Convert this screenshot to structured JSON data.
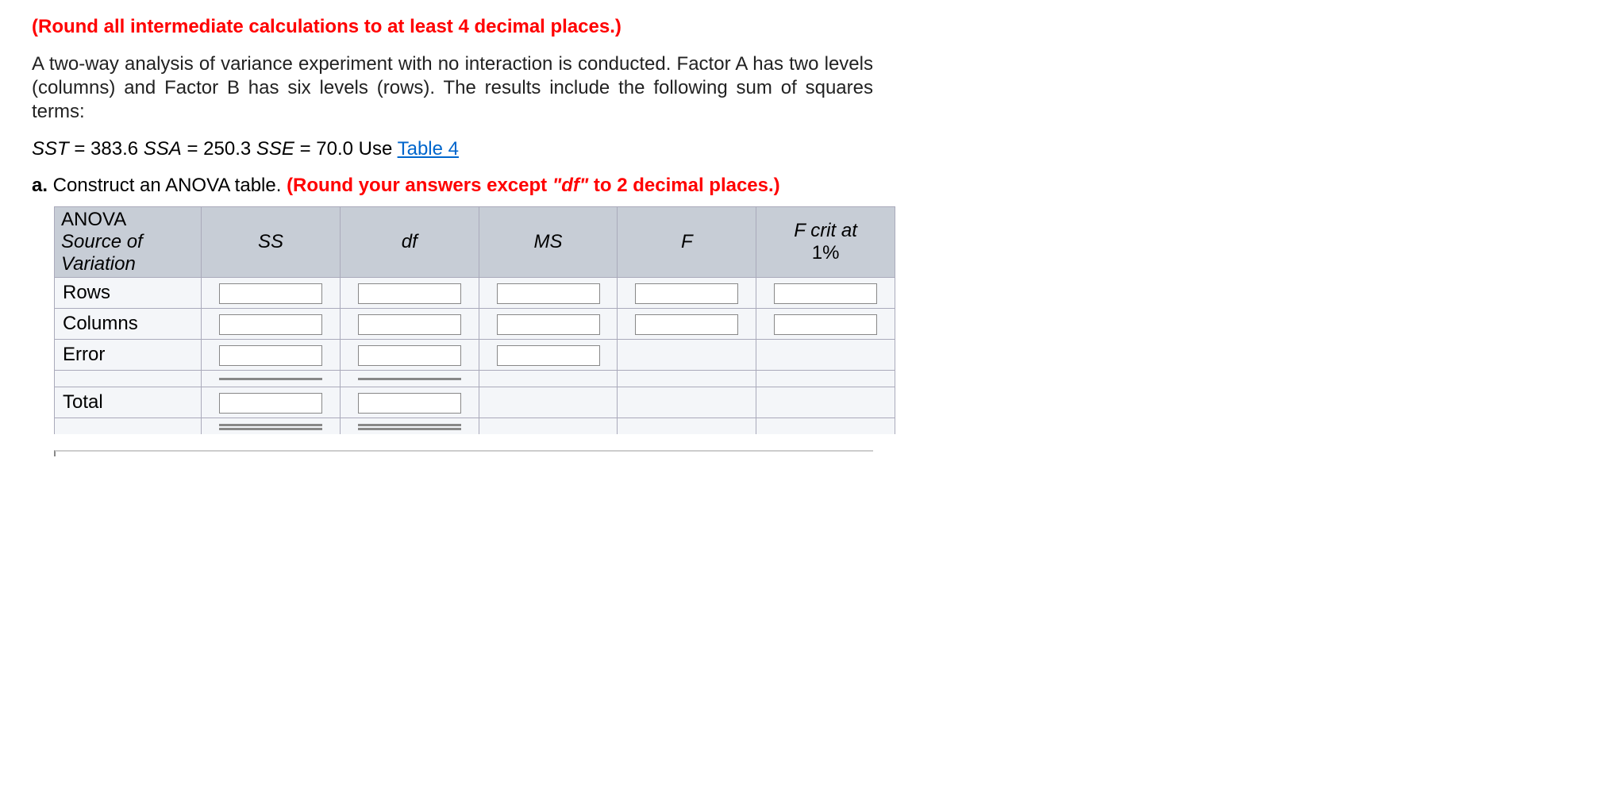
{
  "instruction": "(Round all intermediate calculations to at least 4 decimal places.)",
  "paragraph": "A two-way analysis of variance experiment with no interaction is conducted. Factor A has two levels (columns) and Factor B has six levels (rows). The results include the following sum of squares terms:",
  "formula": {
    "sst_label": "SST",
    "sst_val": "= 383.6",
    "ssa_label": "SSA",
    "ssa_val": "= 250.3",
    "sse_label": "SSE",
    "sse_val": "= 70.0 Use ",
    "link": "Table 4"
  },
  "part_a": {
    "label": "a.",
    "text1": " Construct an ANOVA table. ",
    "red1": "(Round your answers except ",
    "red_df": "\"df\"",
    "red2": " to 2 decimal places.)"
  },
  "table": {
    "title": "ANOVA",
    "h_source": "Source of Variation",
    "h_ss": "SS",
    "h_df": "df",
    "h_ms": "MS",
    "h_f": "F",
    "h_fcrit1": "F crit at",
    "h_fcrit2": "1%",
    "r_rows": "Rows",
    "r_columns": "Columns",
    "r_error": "Error",
    "r_total": "Total"
  }
}
